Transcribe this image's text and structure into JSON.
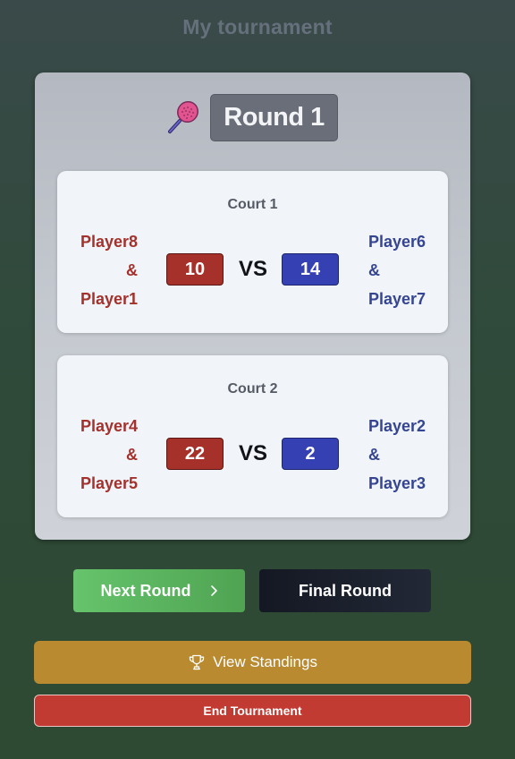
{
  "page": {
    "title": "My tournament"
  },
  "round": {
    "label": "Round 1",
    "icon": "padel-racket-icon"
  },
  "courts": [
    {
      "name": "Court 1",
      "team_left": {
        "player1": "Player8",
        "amp": "&",
        "player2": "Player1"
      },
      "score_left": "10",
      "vs": "VS",
      "score_right": "14",
      "team_right": {
        "player1": "Player6",
        "amp": "&",
        "player2": "Player7"
      }
    },
    {
      "name": "Court 2",
      "team_left": {
        "player1": "Player4",
        "amp": "&",
        "player2": "Player5"
      },
      "score_left": "22",
      "vs": "VS",
      "score_right": "2",
      "team_right": {
        "player1": "Player2",
        "amp": "&",
        "player2": "Player3"
      }
    }
  ],
  "actions": {
    "next_round": "Next Round",
    "final_round": "Final Round",
    "view_standings": "View Standings",
    "end_tournament": "End Tournament"
  },
  "colors": {
    "team_left": "#a3312c",
    "team_right": "#354592",
    "next_button": "#5cb460",
    "final_button": "#1a1f2b",
    "standings_button": "#b98a2f",
    "end_button": "#c13b32"
  }
}
